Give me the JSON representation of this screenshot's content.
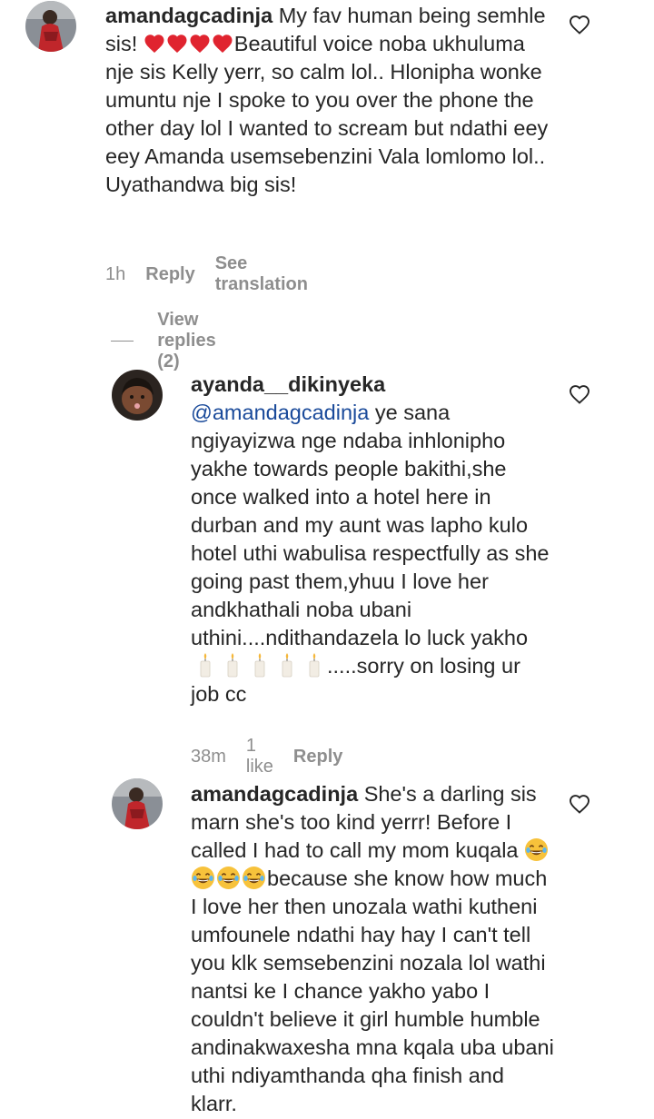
{
  "comments": [
    {
      "username": "amandagcadinja",
      "text_before_emoji": "My fav human being semhle sis! ",
      "emoji_hearts": 4,
      "text_after_emoji": "Beautiful voice noba ukhuluma nje sis Kelly yerr, so calm lol.. Hlonipha wonke umuntu nje I spoke to you over the phone the other day lol I wanted to scream but ndathi eey eey Amanda usemsebenzini Vala lomlomo lol.. Uyathandwa big sis!",
      "time": "1h",
      "reply": "Reply",
      "see_translation": "See translation",
      "view_replies": "View replies (2)",
      "like_icon": "heart-outline-icon"
    },
    {
      "username": "ayanda__dikinyeka",
      "mention": "@amandagcadinja",
      "text": " ye sana ngiyayizwa nge ndaba inhlonipho yakhe towards people bakithi,she once walked into a hotel here in durban and my aunt was lapho kulo hotel uthi wabulisa respectfully as she going past them,yhuu I love her andkhathali noba ubani uthini....ndithandazela lo luck yakho",
      "emoji_candles": 5,
      "text_after_emoji": ".....sorry on losing ur job cc",
      "time": "38m",
      "likes": "1 like",
      "reply": "Reply",
      "like_icon": "heart-outline-icon"
    },
    {
      "username": "amandagcadinja",
      "text_before_emoji": "She's a darling sis marn she's too kind yerrr! Before I called I had to call my mom kuqala ",
      "emoji_laughs": 4,
      "text_after_emoji": "because she know how much I love her then unozala wathi kutheni umfounele ndathi hay hay I can't tell you klk semsebenzini nozala lol wathi nantsi ke I chance yakho yabo I couldn't believe it girl humble humble andinakwaxesha mna kqala uba ubani uthi ndiyamthanda qha finish and klarr.",
      "like_icon": "heart-outline-icon"
    }
  ],
  "colors": {
    "text": "#262626",
    "muted": "#8e8e8e",
    "mention": "#1a4a9a",
    "heart_emoji": "#e0242f",
    "laugh_emoji": "#f7c23b"
  }
}
